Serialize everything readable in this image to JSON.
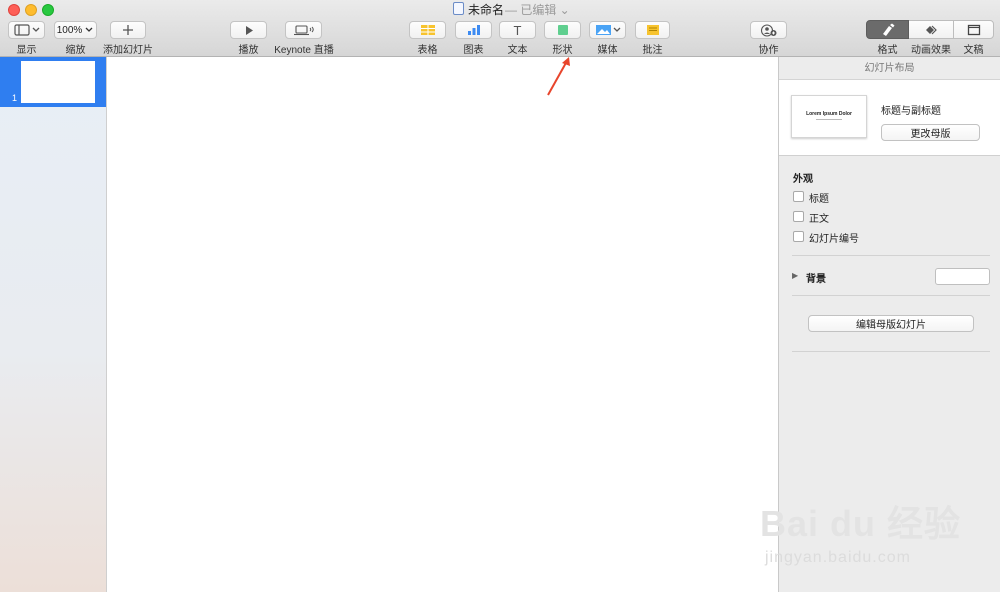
{
  "window": {
    "title": "未命名",
    "status": "— 已编辑 ⌄",
    "traffic_colors": {
      "close": "#fe5f57",
      "minimize": "#febc2e",
      "zoom": "#28c840"
    }
  },
  "toolbar": {
    "view_label": "显示",
    "zoom_value": "100%",
    "zoom_label": "缩放",
    "add_slide_label": "添加幻灯片",
    "play_label": "播放",
    "live_label": "Keynote 直播",
    "table_label": "表格",
    "chart_label": "图表",
    "text_label": "文本",
    "text_glyph": "T",
    "shape_label": "形状",
    "media_label": "媒体",
    "comment_label": "批注",
    "collaborate_label": "协作",
    "format_label": "格式",
    "animate_label": "动画效果",
    "document_label": "文稿"
  },
  "navigator": {
    "slides": [
      {
        "number": "1",
        "selected": true
      }
    ],
    "selection_color": "#2f7ef0"
  },
  "inspector": {
    "panel_title": "幻灯片布局",
    "master_thumb_text": "Lorem Ipsum Dolor",
    "master_name": "标题与副标题",
    "change_master_label": "更改母版",
    "appearance_title": "外观",
    "checkboxes": [
      {
        "label": "标题",
        "checked": false
      },
      {
        "label": "正文",
        "checked": false
      },
      {
        "label": "幻灯片编号",
        "checked": false
      }
    ],
    "background_label": "背景",
    "edit_master_label": "编辑母版幻灯片"
  },
  "annotation": {
    "arrow_color": "#e8452c"
  },
  "watermark": {
    "logo": "Bai du 经验",
    "site": "jingyan.baidu.com"
  }
}
